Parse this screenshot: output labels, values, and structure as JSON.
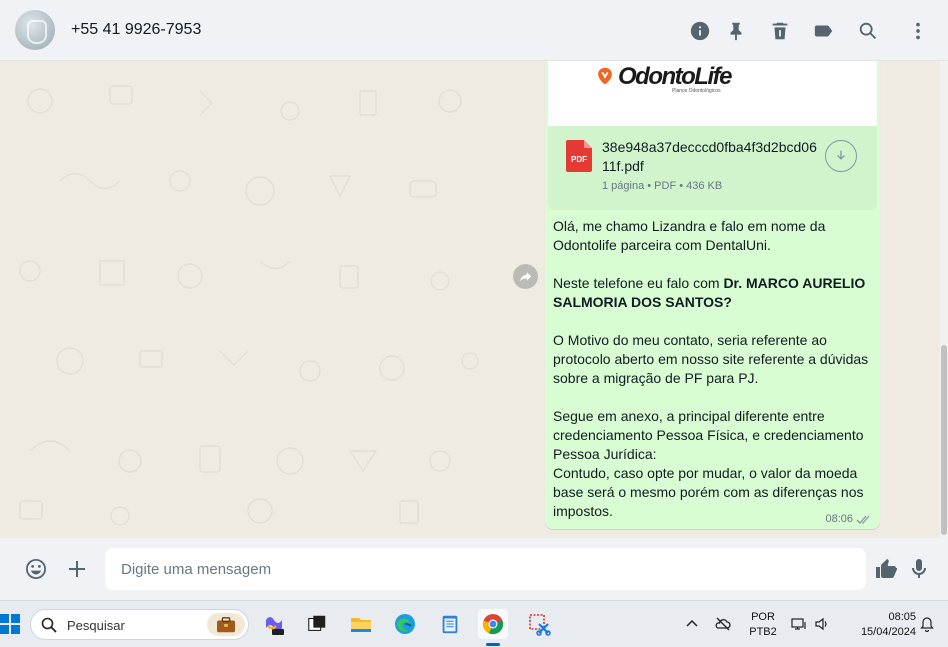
{
  "header": {
    "contact_name": "+55 41 9926-7953",
    "icons": [
      "info-icon",
      "pin-icon",
      "delete-icon",
      "label-icon",
      "search-icon",
      "menu-icon"
    ]
  },
  "message": {
    "logo_text": "OdontoLife",
    "logo_subtext": "Planos Odontológicos",
    "document": {
      "file_name": "38e948a37decccd0fba4f3d2bcd0611f.pdf",
      "meta": "1 página • PDF • 436 KB",
      "icon_label": "PDF"
    },
    "paragraphs": [
      "Olá, me chamo Lizandra e falo em nome da Odontolife parceira com DentalUni.",
      "Neste telefone eu falo com ",
      "Dr. MARCO AURELIO SALMORIA DOS SANTOS?",
      "O Motivo do meu contato, seria referente ao protocolo aberto em nosso site referente a dúvidas sobre a migração de PF para PJ.",
      "Segue em anexo, a principal diferente entre credenciamento Pessoa Física, e credenciamento Pessoa Jurídica:",
      "Contudo, caso opte por mudar, o valor da moeda base será o mesmo porém com as diferenças nos impostos."
    ],
    "time": "08:06",
    "status": "read"
  },
  "composer": {
    "placeholder": "Digite uma mensagem"
  },
  "taskbar": {
    "search_placeholder": "Pesquisar",
    "lang_line1": "POR",
    "lang_line2": "PTB2",
    "clock_time": "08:05",
    "clock_date": "15/04/2024"
  },
  "colors": {
    "bubble": "#d9fdd3",
    "chat_bg": "#efeae2",
    "icon": "#54656f",
    "read_ticks": "#53bdeb",
    "pdf_red": "#e53935"
  }
}
